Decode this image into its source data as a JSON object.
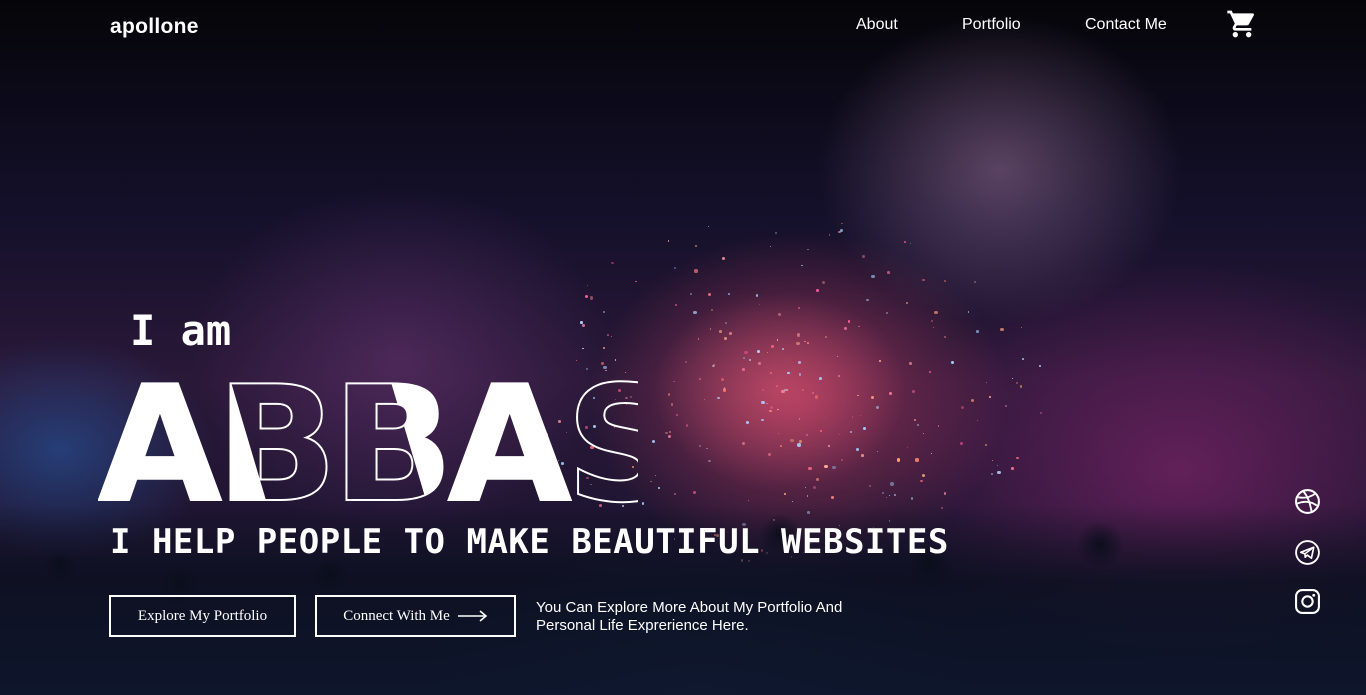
{
  "nav": {
    "brand": "apollone",
    "links": [
      "About",
      "Portfolio",
      "Contact Me"
    ]
  },
  "icons": {
    "cart": "shopping-cart-icon",
    "social": [
      "dribbble-icon",
      "telegram-icon",
      "instagram-icon"
    ]
  },
  "hero": {
    "intro": "I am",
    "name": "ABBAS",
    "tagline": "I HELP PEOPLE TO MAKE BEAUTIFUL WEBSITES",
    "primary_button": "Explore My Portfolio",
    "secondary_button": "Connect With Me",
    "description": "You Can Explore More About My Portfolio And Personal Life Exprerience Here."
  },
  "colors": {
    "text": "#ffffff",
    "background_dark": "#07060d",
    "accent_firework": "#e6466e"
  }
}
